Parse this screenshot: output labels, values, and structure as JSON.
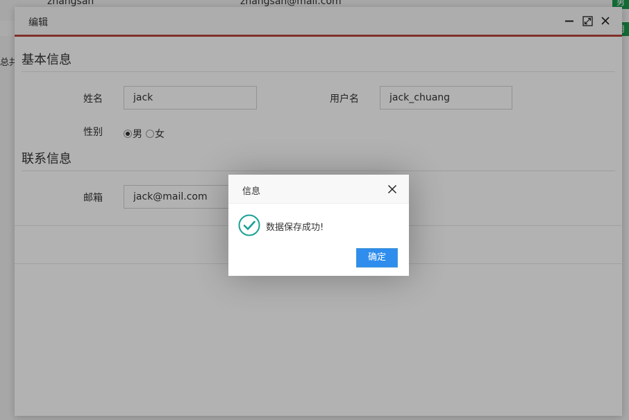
{
  "background": {
    "row_name": "zhangsan",
    "row_email": "zhangsan@mail.com",
    "total_label": "总共",
    "badge_top": "男",
    "badge_bottom": "用"
  },
  "edit_window": {
    "title": "编辑",
    "controls": [
      "minimize-icon",
      "maximize-icon",
      "close-icon"
    ],
    "sections": {
      "basic": {
        "title": "基本信息",
        "name_label": "姓名",
        "name_value": "jack",
        "username_label": "用户名",
        "username_value": "jack_chuang",
        "gender_label": "性别",
        "gender_options": [
          "男",
          "女"
        ],
        "gender_selected": "男"
      },
      "contact": {
        "title": "联系信息",
        "email_label": "邮箱",
        "email_value": "jack@mail.com"
      }
    },
    "accent_color": "#b6453a"
  },
  "message_dialog": {
    "title": "信息",
    "text": "数据保存成功!",
    "icon": "success-check-icon",
    "confirm_label": "确定",
    "icon_color": "#1aa094",
    "button_color": "#2e8ded"
  }
}
